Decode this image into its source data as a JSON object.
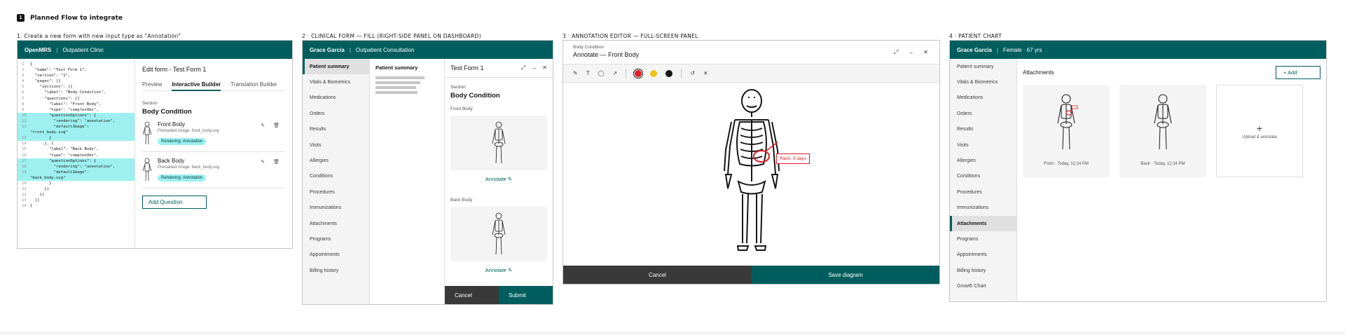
{
  "title": {
    "number": "1",
    "text": "Planned Flow to integrate"
  },
  "steps": {
    "s1": "1. Create a new form with new input type as \"Annotation\"",
    "s2": "2 · CLINICAL FORM — FILL (RIGHT-SIDE PANEL ON DASHBOARD)",
    "s3": "3 · ANNOTATION EDITOR — FULL-SCREEN PANEL",
    "s4": "4 · PATIENT CHART"
  },
  "p1": {
    "brand": "OpenMRS",
    "clinic": "Outpatient Clinic",
    "code": [
      {
        "n": "1",
        "t": "{",
        "hl": false
      },
      {
        "n": "2",
        "t": "  \"name\": \"Test Form 1\",",
        "hl": false
      },
      {
        "n": "3",
        "t": "  \"version\": \"1\",",
        "hl": false
      },
      {
        "n": "4",
        "t": "  \"pages\": [{",
        "hl": false
      },
      {
        "n": "5",
        "t": "    \"sections\": [{",
        "hl": false
      },
      {
        "n": "6",
        "t": "      \"label\": \"Body Condition\",",
        "hl": false
      },
      {
        "n": "7",
        "t": "      \"questions\": [{",
        "hl": false
      },
      {
        "n": "8",
        "t": "        \"label\": \"Front Body\",",
        "hl": false
      },
      {
        "n": "9",
        "t": "        \"type\": \"complexObs\",",
        "hl": false
      },
      {
        "n": "10",
        "t": "        \"questionOptions\": {",
        "hl": true
      },
      {
        "n": "11",
        "t": "          \"rendering\": \"annotation\",",
        "hl": true
      },
      {
        "n": "12",
        "t": "          \"defaultImage\":",
        "hl": true
      },
      {
        "n": "",
        "t": "\"front_body.svg\"",
        "hl": true
      },
      {
        "n": "13",
        "t": "        }",
        "hl": true
      },
      {
        "n": "14",
        "t": "      }, {",
        "hl": false
      },
      {
        "n": "15",
        "t": "        \"label\": \"Back Body\",",
        "hl": false
      },
      {
        "n": "16",
        "t": "        \"type\": \"complexObs\",",
        "hl": false
      },
      {
        "n": "17",
        "t": "        \"questionOptions\": {",
        "hl": true
      },
      {
        "n": "18",
        "t": "          \"rendering\": \"annotation\",",
        "hl": true
      },
      {
        "n": "19",
        "t": "          \"defaultImage\":",
        "hl": true
      },
      {
        "n": "",
        "t": "\"back_body.svg\"",
        "hl": true
      },
      {
        "n": "20",
        "t": "        }",
        "hl": false
      },
      {
        "n": "21",
        "t": "      }]",
        "hl": false
      },
      {
        "n": "22",
        "t": "    }]",
        "hl": false
      },
      {
        "n": "23",
        "t": "  }]",
        "hl": false
      },
      {
        "n": "24",
        "t": "}",
        "hl": false
      }
    ],
    "edit_title": "Edit form - Test Form 1",
    "tabs": [
      "Preview",
      "Interactive Builder",
      "Translation Builder"
    ],
    "section_small": "Section",
    "section_name": "Body Condition",
    "questions": [
      {
        "label": "Front Body",
        "sub": "Preloaded image: front_body.svg",
        "pill": "Rendering: Annotation"
      },
      {
        "label": "Back Body",
        "sub": "Preloaded image: back_body.svg",
        "pill": "Rendering: Annotation"
      }
    ],
    "add_question": "Add Question"
  },
  "p2": {
    "patient": "Grace Garcia",
    "visit": "Outpatient Consultation",
    "nav": [
      "Patient summary",
      "Vitals & Biometrics",
      "Medications",
      "Orders",
      "Results",
      "Visits",
      "Allergies",
      "Conditions",
      "Procedures",
      "Immunizations",
      "Attachments",
      "Programs",
      "Appointments",
      "Billing history"
    ],
    "summary_title": "Patient summary",
    "form_title": "Test Form 1",
    "section_small": "Section",
    "section_name": "Body Condition",
    "front_label": "Front Body",
    "back_label": "Back Body",
    "annotate": "Annotate ✎",
    "cancel": "Cancel",
    "submit": "Submit"
  },
  "p3": {
    "small": "Body Condition",
    "title": "Annotate — Front Body",
    "tag": "Rash, 3 days",
    "cancel": "Cancel",
    "save": "Save diagram",
    "colors": {
      "red": "#da1e28",
      "yellow": "#f1c21b",
      "black": "#161616"
    }
  },
  "p4": {
    "patient": "Grace Garcia",
    "meta": "Female · 67 yrs",
    "nav": [
      "Patient summary",
      "Vitals & Biometrics",
      "Medications",
      "Orders",
      "Results",
      "Visits",
      "Allergies",
      "Conditions",
      "Procedures",
      "Immunizations",
      "Attachments",
      "Programs",
      "Appointments",
      "Billing history",
      "Growth Chart"
    ],
    "attachments": "Attachments",
    "add": "+ Add",
    "front_cap": "Front · Today, 12:24 PM",
    "back_cap": "Back · Today, 12:24 PM",
    "plus": "+",
    "upload": "Upload & annotate"
  },
  "accent": "#005d5d"
}
